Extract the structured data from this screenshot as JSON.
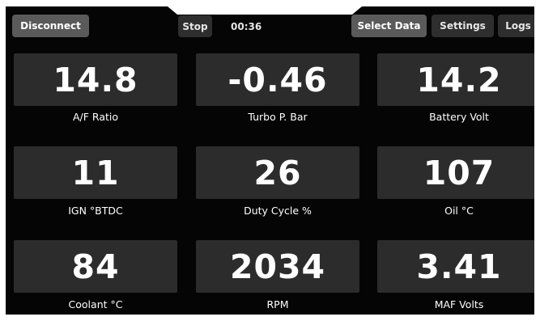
{
  "toolbar": {
    "disconnect_label": "Disconnect",
    "stop_label": "Stop",
    "timer": "00:36",
    "select_data_label": "Select Data",
    "settings_label": "Settings",
    "logs_label": "Logs"
  },
  "gauges": [
    {
      "value": "14.8",
      "label": "A/F Ratio"
    },
    {
      "value": "-0.46",
      "label": "Turbo P. Bar"
    },
    {
      "value": "14.2",
      "label": "Battery Volt"
    },
    {
      "value": "11",
      "label": "IGN °BTDC"
    },
    {
      "value": "26",
      "label": "Duty Cycle %"
    },
    {
      "value": "107",
      "label": "Oil °C"
    },
    {
      "value": "84",
      "label": "Coolant °C"
    },
    {
      "value": "2034",
      "label": "RPM"
    },
    {
      "value": "3.41",
      "label": "MAF Volts"
    }
  ],
  "colors": {
    "background": "#050505",
    "tile": "#2c2c2c",
    "active_button": "#5a5a5a",
    "inactive_button": "#2e2e2e",
    "text": "#ffffff"
  }
}
